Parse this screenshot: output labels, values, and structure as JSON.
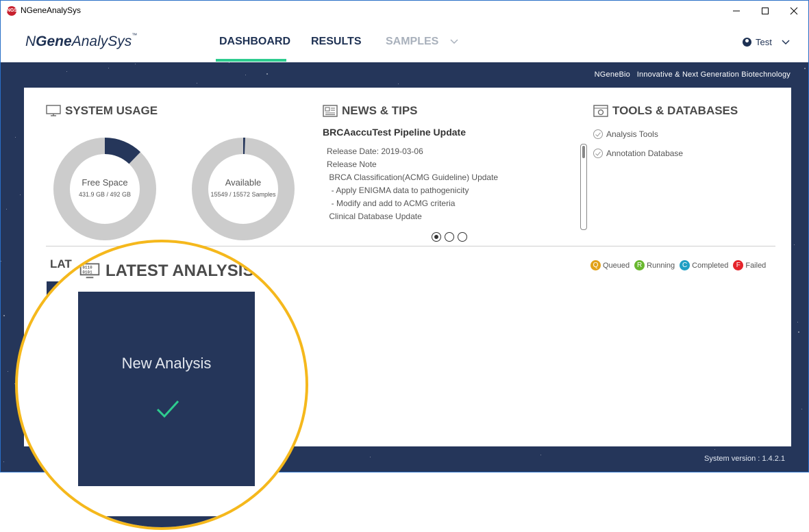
{
  "window": {
    "title": "NGeneAnalySys",
    "app_icon_text": "NGS"
  },
  "nav": {
    "logo_prefix": "N",
    "logo_bold": "Gene",
    "logo_suffix": "AnalySys",
    "logo_tm": "™",
    "tabs": [
      "DASHBOARD",
      "RESULTS",
      "SAMPLES"
    ],
    "active_tab": "DASHBOARD",
    "user": "Test"
  },
  "tagline": "NGeneBio   Innovative & Next Generation Biotechnology",
  "version": "System version : 1.4.2.1",
  "system_usage": {
    "title": "SYSTEM USAGE",
    "free_space": {
      "label": "Free Space",
      "detail": "431.9 GB / 492 GB",
      "fraction": 0.878
    },
    "available": {
      "label": "Available",
      "detail": "15549 / 15572 Samples",
      "fraction": 0.9985
    }
  },
  "news": {
    "title": "NEWS & TIPS",
    "headline": "BRCAaccuTest Pipeline Update",
    "lines": [
      "Release Date: 2019-03-06",
      "Release Note",
      "",
      " BRCA Classification(ACMG Guideline) Update",
      "  - Apply ENIGMA data to pathogenicity",
      "  - Modify and add to ACMG criteria",
      " Clinical Database Update"
    ],
    "page_count": 3,
    "active_page": 1
  },
  "tools": {
    "title": "TOOLS & DATABASES",
    "items": [
      "Analysis Tools",
      "Annotation Database"
    ]
  },
  "latest": {
    "title": "LATEST ANALYSIS",
    "title_small": "LAT",
    "card_label": "New Analysis",
    "legend": [
      {
        "letter": "Q",
        "label": "Queued",
        "color": "#e2a21a"
      },
      {
        "letter": "R",
        "label": "Running",
        "color": "#69b82f"
      },
      {
        "letter": "C",
        "label": "Completed",
        "color": "#1f9fc4"
      },
      {
        "letter": "F",
        "label": "Failed",
        "color": "#e5242b"
      }
    ]
  },
  "colors": {
    "navy": "#25365a",
    "accent": "#2ecc8f",
    "highlight": "#f5b81c"
  }
}
